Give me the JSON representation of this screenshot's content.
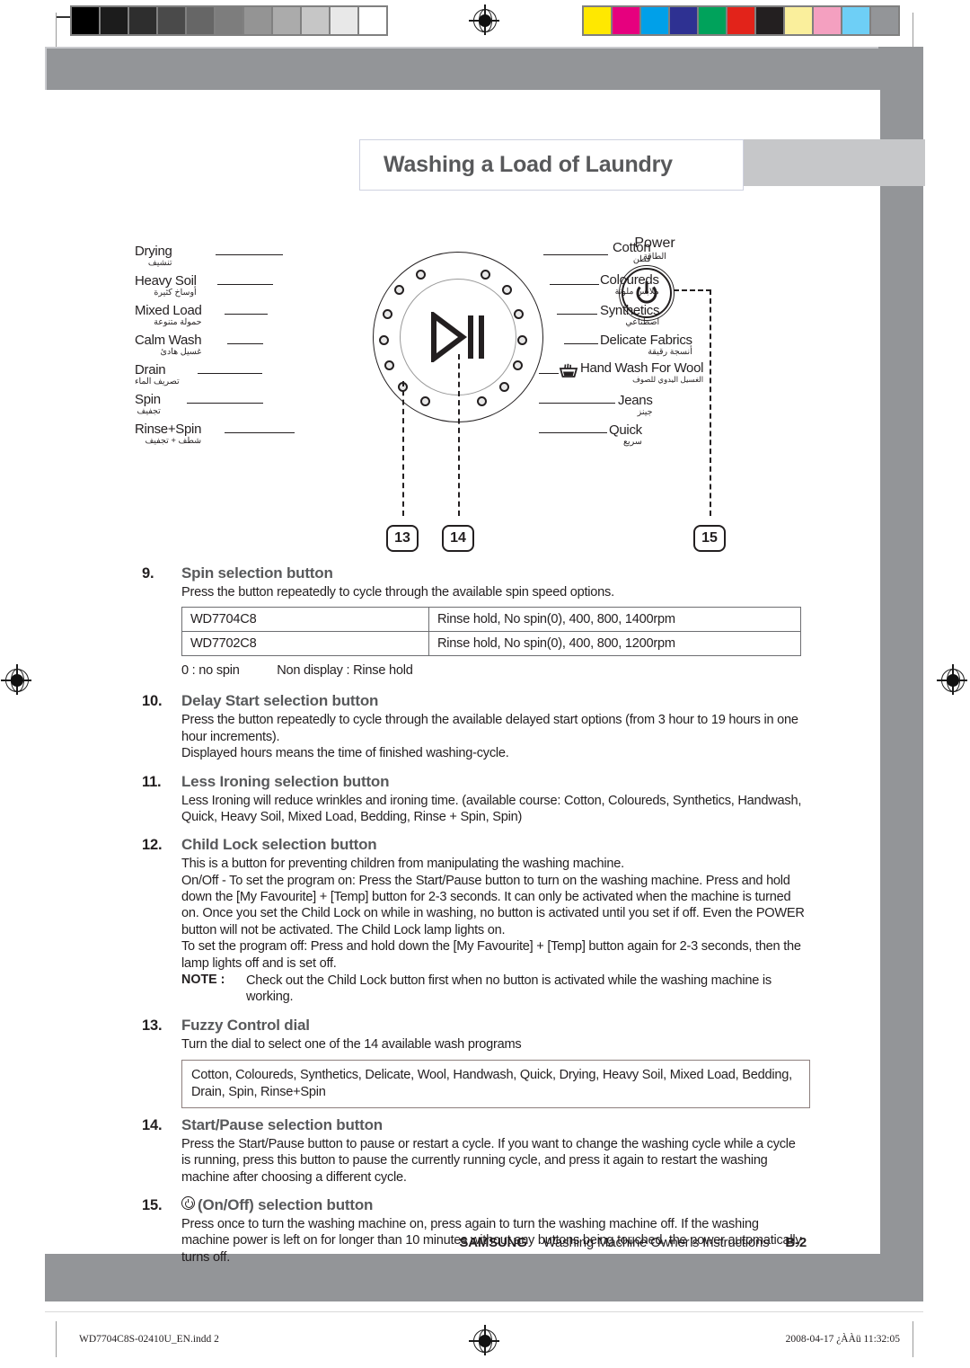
{
  "header": {
    "title": "Washing a Load of Laundry"
  },
  "diagram": {
    "center_icon": "play-pause-icon",
    "left_labels": [
      {
        "en": "Drying",
        "ar": "تنشيف"
      },
      {
        "en": "Heavy Soil",
        "ar": "أوساخ كثيرة"
      },
      {
        "en": "Mixed Load",
        "ar": "حمولة متنوعة"
      },
      {
        "en": "Calm Wash",
        "ar": "غسيل هادئ"
      },
      {
        "en": "Drain",
        "ar": "تصريف الماء"
      },
      {
        "en": "Spin",
        "ar": "تجفيف"
      },
      {
        "en": "Rinse+Spin",
        "ar": "شطف + تجفيف"
      }
    ],
    "right_labels": [
      {
        "en": "Cotton",
        "ar": "قطن"
      },
      {
        "en": "Coloureds",
        "ar": "ملابس ملونة"
      },
      {
        "en": "Synthetics",
        "ar": "اصطناعي"
      },
      {
        "en": "Delicate Fabrics",
        "ar": "أنسجة رقيقة"
      },
      {
        "en": "Hand Wash For Wool",
        "ar": "الغسيل اليدوي للصوف"
      },
      {
        "en": "Jeans",
        "ar": "جينز"
      },
      {
        "en": "Quick",
        "ar": "سريع"
      }
    ],
    "power": {
      "en": "Power",
      "ar": "الطاقة",
      "icon": "power-icon"
    },
    "callouts": [
      "13",
      "14",
      "15"
    ]
  },
  "sections": [
    {
      "num": "9.",
      "title": "Spin selection button",
      "intro": "Press the button repeatedly to cycle through the available spin speed options.",
      "table": [
        {
          "model": "WD7704C8",
          "speeds": "Rinse hold, No spin(0), 400, 800, 1400rpm"
        },
        {
          "model": "WD7702C8",
          "speeds": "Rinse hold, No spin(0), 400, 800, 1200rpm"
        }
      ],
      "footnote_a": "0 : no spin",
      "footnote_b": "Non display : Rinse hold"
    },
    {
      "num": "10.",
      "title": "Delay Start selection button",
      "paragraphs": [
        "Press the button repeatedly to cycle through the available delayed start options (from 3 hour to 19 hours in one hour increments).",
        "Displayed hours means the time of finished washing-cycle."
      ]
    },
    {
      "num": "11.",
      "title": "Less Ironing selection button",
      "paragraphs": [
        "Less Ironing will reduce wrinkles and ironing time. (available course: Cotton, Coloureds, Synthetics, Handwash, Quick, Heavy Soil, Mixed Load, Bedding, Rinse + Spin, Spin)"
      ]
    },
    {
      "num": "12.",
      "title": "Child Lock selection button",
      "paragraphs": [
        "This is a button for preventing children from manipulating the washing machine.",
        "On/Off - To set the program on: Press the Start/Pause button to turn on the washing machine. Press and hold down the [My Favourite] + [Temp] button for 2-3 seconds. It can only be activated when the machine is turned on. Once you set the Child Lock on while in washing, no button is activated until you set if off. Even the POWER button will not be activated. The Child Lock lamp lights on.",
        "To set the program off: Press and hold down the [My Favourite] + [Temp] button again for 2-3 seconds, then the lamp lights off and is set off."
      ],
      "note_label": "NOTE :",
      "note_text": "Check out the Child Lock button first when no button is activated while the washing machine is working."
    },
    {
      "num": "13.",
      "title": "Fuzzy Control dial",
      "intro": "Turn the dial to select one of the 14 available wash programs",
      "programs_box": "Cotton, Coloureds, Synthetics, Delicate, Wool, Handwash, Quick, Drying, Heavy Soil, Mixed Load, Bedding, Drain, Spin, Rinse+Spin"
    },
    {
      "num": "14.",
      "title": "Start/Pause selection button",
      "paragraphs": [
        "Press the Start/Pause button to pause or restart a cycle. If you want to change the washing cycle while a cycle is running, press this button to pause the currently running cycle, and press it again to restart the washing machine after choosing a different cycle."
      ]
    },
    {
      "num": "15.",
      "title_prefix_icon": "power-small-icon",
      "title": "(On/Off) selection button",
      "paragraphs": [
        "Press once to turn the washing machine on, press again to turn the washing machine off. If the washing machine power is left on for longer than 10 minutes without any buttons being touched, the power automatically turns off."
      ]
    }
  ],
  "footer": {
    "brand": "SAMSUNG",
    "text": "Washing Machine Owner’s Instructions",
    "page": "B-2"
  },
  "imprint": {
    "file": "WD7704C8S-02410U_EN.indd   2",
    "timestamp": "2008-04-17   ¿ÀÀü 11:32:05"
  },
  "calibration": {
    "grayscale": [
      "#000000",
      "#1c1c1c",
      "#2e2e2e",
      "#4a4a4a",
      "#666666",
      "#7d7d7d",
      "#949494",
      "#ababab",
      "#c6c6c6",
      "#e8e8e8",
      "#ffffff"
    ],
    "colors": [
      "#ffe800",
      "#e6007e",
      "#00a0e9",
      "#2e3192",
      "#00a25b",
      "#e2231a",
      "#231f20",
      "#faef9c",
      "#f4a0c0",
      "#6ecff6",
      "#939598"
    ]
  },
  "colors": {
    "band_gray": "#939598",
    "title_gray": "#c6c7c9",
    "heading_gray": "#58595b",
    "ink": "#231f20"
  }
}
